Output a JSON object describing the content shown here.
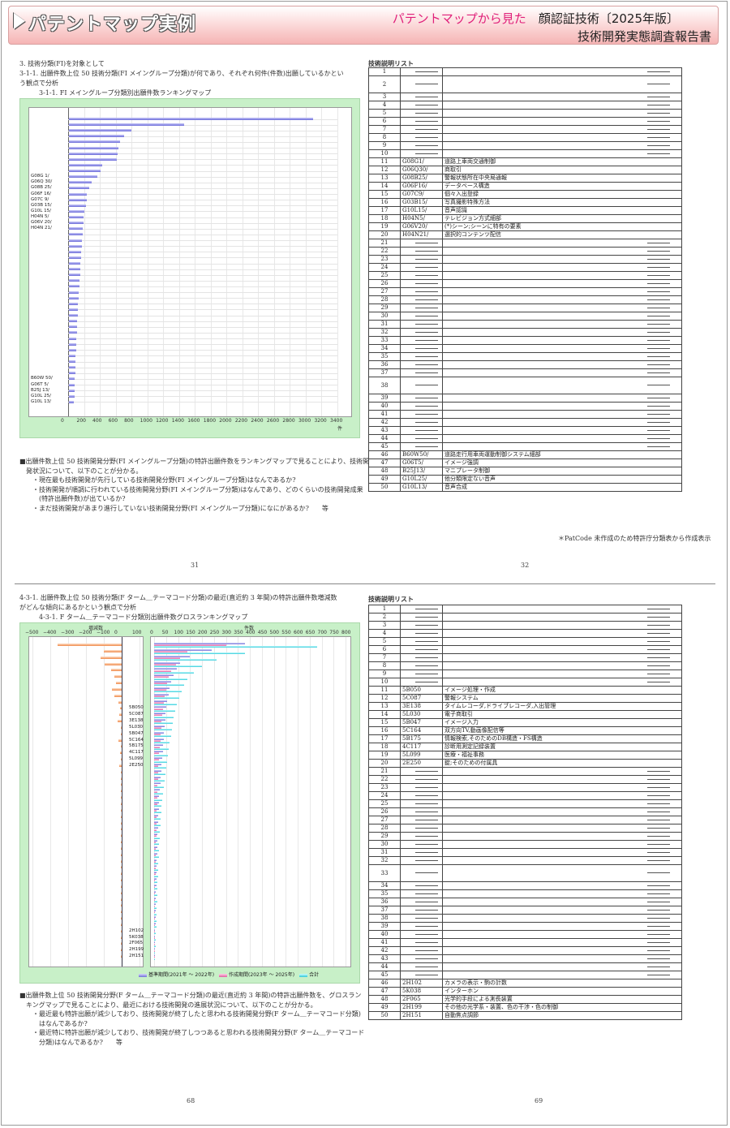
{
  "header": {
    "title": "パテントマップ実例",
    "subtitle_pink": "パテントマップから見た",
    "subtitle_black": "顔認証技術〔2025年版〕",
    "subtitle_line2": "技術開発実態調査報告書"
  },
  "top": {
    "heading1": "3. 技術分類(FI)を対象として",
    "heading2": "3-1-1. 出願件数上位 50 技術分類(FI メイングループ分類)が何であり、それぞれ何件(件数)出願しているかとい",
    "heading3": "う観点で分析",
    "chart_title": "3-1-1. FI メイングループ分類別出願件数ランキングマップ",
    "axis_unit": "件",
    "ticks": [
      "0",
      "200",
      "400",
      "600",
      "800",
      "1000",
      "1200",
      "1400",
      "1600",
      "1800",
      "2000",
      "2200",
      "2400",
      "2600",
      "2800",
      "3000",
      "3200",
      "3400"
    ],
    "labels_mid": [
      "G08G 1/",
      "G06Q 30/",
      "G08B 25/",
      "G06F 16/",
      "G07C 9/",
      "G03B 15/",
      "G10L 15/",
      "H04N 5/",
      "G06V 20/",
      "H04N 21/"
    ],
    "labels_bot": [
      "B60W 50/",
      "G06T 5/",
      "B25J 13/",
      "G10L 25/",
      "G10L 13/"
    ],
    "notes": [
      "■出願件数上位 50 技術開発分野(FI メイングループ分類)の特許出願件数をランキングマップで見ることにより、技術開",
      "　発状況について、以下のことが分かる。",
      "　　・現在最も技術開発が先行している技術開発分野(FI メイングループ分類)はなんであるか?",
      "　　・技術開発が順調に行われている技術開発分野(FI メイングループ分類)はなんであり、どのくらいの技術開発成果",
      "　　　(特許出願件数)が出ているか?",
      "　　・まだ技術開発があまり進行していない技術開発分野(FI メイングループ分類)になにがあるか?　　等"
    ],
    "page_left": "31",
    "page_right": "32",
    "list_title": "技術説明リスト",
    "footnote": "＊PatCode 未作成のため特許庁分類表から作成表示",
    "rows": [
      {
        "n": "1",
        "c": "",
        "d": ""
      },
      {
        "n": "2",
        "c": "",
        "d": ""
      },
      {
        "n": "3",
        "c": "",
        "d": ""
      },
      {
        "n": "4",
        "c": "",
        "d": ""
      },
      {
        "n": "5",
        "c": "",
        "d": ""
      },
      {
        "n": "6",
        "c": "",
        "d": ""
      },
      {
        "n": "7",
        "c": "",
        "d": ""
      },
      {
        "n": "8",
        "c": "",
        "d": ""
      },
      {
        "n": "9",
        "c": "",
        "d": ""
      },
      {
        "n": "10",
        "c": "",
        "d": ""
      },
      {
        "n": "11",
        "c": "G08G1/",
        "d": "道路上車両交通制御"
      },
      {
        "n": "12",
        "c": "G06Q30/",
        "d": "商取引"
      },
      {
        "n": "13",
        "c": "G08B25/",
        "d": "警報状態所在中央局通報"
      },
      {
        "n": "14",
        "c": "G06F16/",
        "d": "データベース構造"
      },
      {
        "n": "15",
        "c": "G07C9/",
        "d": "個々入出登録"
      },
      {
        "n": "16",
        "c": "G03B15/",
        "d": "写真撮影特殊方法"
      },
      {
        "n": "17",
        "c": "G10L15/",
        "d": "音声認識"
      },
      {
        "n": "18",
        "c": "H04N5/",
        "d": "テレビジョン方式細部"
      },
      {
        "n": "19",
        "c": "G06V20/",
        "d": "(*)シーン;シーンに特有の要素"
      },
      {
        "n": "20",
        "c": "H04N21/",
        "d": "選択的コンテンツ配信"
      },
      {
        "n": "21",
        "c": "",
        "d": ""
      },
      {
        "n": "22",
        "c": "",
        "d": ""
      },
      {
        "n": "23",
        "c": "",
        "d": ""
      },
      {
        "n": "24",
        "c": "",
        "d": ""
      },
      {
        "n": "25",
        "c": "",
        "d": ""
      },
      {
        "n": "26",
        "c": "",
        "d": ""
      },
      {
        "n": "27",
        "c": "",
        "d": ""
      },
      {
        "n": "28",
        "c": "",
        "d": ""
      },
      {
        "n": "29",
        "c": "",
        "d": ""
      },
      {
        "n": "30",
        "c": "",
        "d": ""
      },
      {
        "n": "31",
        "c": "",
        "d": ""
      },
      {
        "n": "32",
        "c": "",
        "d": ""
      },
      {
        "n": "33",
        "c": "",
        "d": ""
      },
      {
        "n": "34",
        "c": "",
        "d": ""
      },
      {
        "n": "35",
        "c": "",
        "d": ""
      },
      {
        "n": "36",
        "c": "",
        "d": ""
      },
      {
        "n": "37",
        "c": "",
        "d": ""
      },
      {
        "n": "38",
        "c": "",
        "d": ""
      },
      {
        "n": "39",
        "c": "",
        "d": ""
      },
      {
        "n": "40",
        "c": "",
        "d": ""
      },
      {
        "n": "41",
        "c": "",
        "d": ""
      },
      {
        "n": "42",
        "c": "",
        "d": ""
      },
      {
        "n": "43",
        "c": "",
        "d": ""
      },
      {
        "n": "44",
        "c": "",
        "d": ""
      },
      {
        "n": "45",
        "c": "",
        "d": ""
      },
      {
        "n": "46",
        "c": "B60W50/",
        "d": "道路走行用車両運動制御システム細部"
      },
      {
        "n": "47",
        "c": "G06T5/",
        "d": "イメージ強調"
      },
      {
        "n": "48",
        "c": "B25J13/",
        "d": "マニプレータ制御"
      },
      {
        "n": "49",
        "c": "G10L25/",
        "d": "他分類限定ない音声"
      },
      {
        "n": "50",
        "c": "G10L13/",
        "d": "音声合成"
      }
    ]
  },
  "bottom": {
    "heading1": "4-3-1. 出願件数上位 50 技術分類(F ターム＿テーマコード分類)の最近(直近約 3 年間)の特許出願件数増減数",
    "heading2": "がどんな傾向にあるかという観点で分析",
    "chart_title": "4-3-1. F ターム＿テーマコード分類別出願件数グロスランキングマップ",
    "left_axis_label": "増減数",
    "right_axis_label": "件数",
    "left_ticks": [
      "−500",
      "−400",
      "−300",
      "−200",
      "−100",
      "0",
      "100"
    ],
    "right_ticks": [
      "0",
      "50",
      "100",
      "150",
      "200",
      "250",
      "300",
      "350",
      "400",
      "450",
      "500",
      "550",
      "600",
      "650",
      "700",
      "750",
      "800"
    ],
    "labels_mid": [
      "5B050",
      "5C087",
      "3E138",
      "5L030",
      "5B047",
      "5C164",
      "5B175",
      "4C117",
      "5L099",
      "2E250"
    ],
    "labels_bot": [
      "2H102",
      "5K038",
      "2F065",
      "2H199",
      "2H151"
    ],
    "legend": [
      "基準期間(2021年 〜 2022年)",
      "作成期間(2023年 〜 2025年)",
      "合計"
    ],
    "notes": [
      "■出願件数上位 50 技術開発分野(F ターム＿テーマコード分類)の最近(直近約 3 年間)の特許出願件数を、グロスラン",
      "　キングマップで見ることにより、最近における技術開発の進展状況について、以下のことが分かる。",
      "　　・最近最も特許出願が減少しており、技術開発が終了したと思われる技術開発分野(F ターム＿テーマコード分類)",
      "　　　はなんであるか?",
      "　　・最近特に特許出願が減少しており、技術開発が終了しつつあると思われる技術開発分野(F ターム＿テーマコード",
      "　　　分類)はなんであるか?　　等"
    ],
    "page_left": "68",
    "page_right": "69",
    "list_title": "技術説明リスト",
    "rows": [
      {
        "n": "1",
        "c": "",
        "d": ""
      },
      {
        "n": "2",
        "c": "",
        "d": ""
      },
      {
        "n": "3",
        "c": "",
        "d": ""
      },
      {
        "n": "4",
        "c": "",
        "d": ""
      },
      {
        "n": "5",
        "c": "",
        "d": ""
      },
      {
        "n": "6",
        "c": "",
        "d": ""
      },
      {
        "n": "7",
        "c": "",
        "d": ""
      },
      {
        "n": "8",
        "c": "",
        "d": ""
      },
      {
        "n": "9",
        "c": "",
        "d": ""
      },
      {
        "n": "10",
        "c": "",
        "d": ""
      },
      {
        "n": "11",
        "c": "5B050",
        "d": "イメージ処理・作成"
      },
      {
        "n": "12",
        "c": "5C087",
        "d": "警報システム"
      },
      {
        "n": "13",
        "c": "3E138",
        "d": "タイムレコーダ,ドライブレコーダ,入出管理"
      },
      {
        "n": "14",
        "c": "5L030",
        "d": "電子商取引"
      },
      {
        "n": "15",
        "c": "5B047",
        "d": "イメージ入力"
      },
      {
        "n": "16",
        "c": "5C164",
        "d": "双方向TV,動画像配信等"
      },
      {
        "n": "17",
        "c": "5B175",
        "d": "情報検索,そのためのDB構造・FS構造"
      },
      {
        "n": "18",
        "c": "4C117",
        "d": "診断用測定記録装置"
      },
      {
        "n": "19",
        "c": "5L099",
        "d": "医療・福祉事務"
      },
      {
        "n": "20",
        "c": "2E250",
        "d": "錠;そのための付属具"
      },
      {
        "n": "21",
        "c": "",
        "d": ""
      },
      {
        "n": "22",
        "c": "",
        "d": ""
      },
      {
        "n": "23",
        "c": "",
        "d": ""
      },
      {
        "n": "24",
        "c": "",
        "d": ""
      },
      {
        "n": "25",
        "c": "",
        "d": ""
      },
      {
        "n": "26",
        "c": "",
        "d": ""
      },
      {
        "n": "27",
        "c": "",
        "d": ""
      },
      {
        "n": "28",
        "c": "",
        "d": ""
      },
      {
        "n": "29",
        "c": "",
        "d": ""
      },
      {
        "n": "30",
        "c": "",
        "d": ""
      },
      {
        "n": "31",
        "c": "",
        "d": ""
      },
      {
        "n": "32",
        "c": "",
        "d": ""
      },
      {
        "n": "33",
        "c": "",
        "d": ""
      },
      {
        "n": "34",
        "c": "",
        "d": ""
      },
      {
        "n": "35",
        "c": "",
        "d": ""
      },
      {
        "n": "36",
        "c": "",
        "d": ""
      },
      {
        "n": "37",
        "c": "",
        "d": ""
      },
      {
        "n": "38",
        "c": "",
        "d": ""
      },
      {
        "n": "39",
        "c": "",
        "d": ""
      },
      {
        "n": "40",
        "c": "",
        "d": ""
      },
      {
        "n": "41",
        "c": "",
        "d": ""
      },
      {
        "n": "42",
        "c": "",
        "d": ""
      },
      {
        "n": "43",
        "c": "",
        "d": ""
      },
      {
        "n": "44",
        "c": "",
        "d": ""
      },
      {
        "n": "45",
        "c": "",
        "d": ""
      },
      {
        "n": "46",
        "c": "2H102",
        "d": "カメラの表示・駒の計数"
      },
      {
        "n": "47",
        "c": "5K038",
        "d": "インターホン"
      },
      {
        "n": "48",
        "c": "2F065",
        "d": "光学的手段による測長装置"
      },
      {
        "n": "49",
        "c": "2H199",
        "d": "その他の光学系・装置、色の干渉・色の制御"
      },
      {
        "n": "50",
        "c": "2H151",
        "d": "自動焦点調節"
      }
    ]
  },
  "chart_data": [
    {
      "type": "bar",
      "orientation": "horizontal",
      "title": "3-1-1. FI メイングループ分類別出願件数ランキングマップ",
      "xlabel": "件",
      "xlim": [
        0,
        3400
      ],
      "categories_count": 50,
      "values": [
        3080,
        1450,
        790,
        700,
        650,
        620,
        610,
        600,
        420,
        395,
        360,
        290,
        255,
        230,
        225,
        220,
        190,
        185,
        180,
        175,
        170,
        165,
        160,
        155,
        150,
        145,
        140,
        140,
        135,
        130,
        125,
        120,
        115,
        110,
        110,
        105,
        100,
        100,
        95,
        90,
        90,
        85,
        85,
        80,
        80,
        75,
        75,
        70,
        70,
        65
      ]
    },
    {
      "type": "bar",
      "orientation": "horizontal",
      "title": "4-3-1. F ターム＿テーマコード分類別出願件数グロスランキングマップ",
      "categories_count": 50,
      "left": {
        "xlabel": "増減数",
        "xlim": [
          -500,
          100
        ],
        "values": [
          -360,
          -100,
          -120,
          -95,
          -60,
          -40,
          -30,
          -55,
          -40,
          -20,
          -10,
          -15,
          -25,
          -5,
          -5,
          -20,
          -5,
          -10,
          -5,
          -15,
          -5,
          -5,
          -5,
          -5,
          -5,
          -5,
          -5,
          -5,
          -5,
          -5,
          -5,
          -5,
          -5,
          -5,
          -5,
          -5,
          -5,
          -5,
          -5,
          -5,
          -5,
          -5,
          -5,
          -5,
          -5,
          -5,
          -5,
          -5,
          -5,
          -5
        ]
      },
      "right": {
        "xlabel": "件数",
        "xlim": [
          0,
          800
        ],
        "series": [
          {
            "name": "基準期間(2021年 〜 2022年)",
            "values": [
              380,
              240,
              150,
              110,
              95,
              80,
              70,
              65,
              60,
              55,
              50,
              48,
              46,
              44,
              42,
              40,
              38,
              36,
              34,
              32,
              30,
              28,
              26,
              24,
              22,
              20,
              19,
              18,
              17,
              16,
              15,
              14,
              13,
              12,
              11,
              10,
              10,
              9,
              9,
              8,
              8,
              7,
              7,
              6,
              6,
              5,
              5,
              4,
              4,
              3
            ]
          },
          {
            "name": "作成期間(2023年 〜 2025年)",
            "values": [
              300,
              140,
              110,
              90,
              70,
              60,
              55,
              50,
              45,
              40,
              38,
              35,
              32,
              30,
              28,
              26,
              24,
              22,
              20,
              18,
              17,
              16,
              15,
              14,
              13,
              12,
              11,
              10,
              10,
              9,
              9,
              8,
              8,
              7,
              7,
              6,
              6,
              5,
              5,
              4,
              4,
              4,
              3,
              3,
              3,
              2,
              2,
              2,
              1,
              1
            ]
          },
          {
            "name": "合計",
            "values": [
              680,
              380,
              260,
              200,
              165,
              140,
              125,
              115,
              105,
              95,
              88,
              83,
              78,
              74,
              70,
              66,
              62,
              58,
              54,
              50,
              47,
              44,
              41,
              38,
              35,
              32,
              30,
              28,
              27,
              25,
              24,
              22,
              21,
              19,
              18,
              16,
              16,
              14,
              14,
              12,
              12,
              11,
              10,
              9,
              9,
              7,
              7,
              6,
              5,
              4
            ]
          }
        ]
      }
    }
  ]
}
